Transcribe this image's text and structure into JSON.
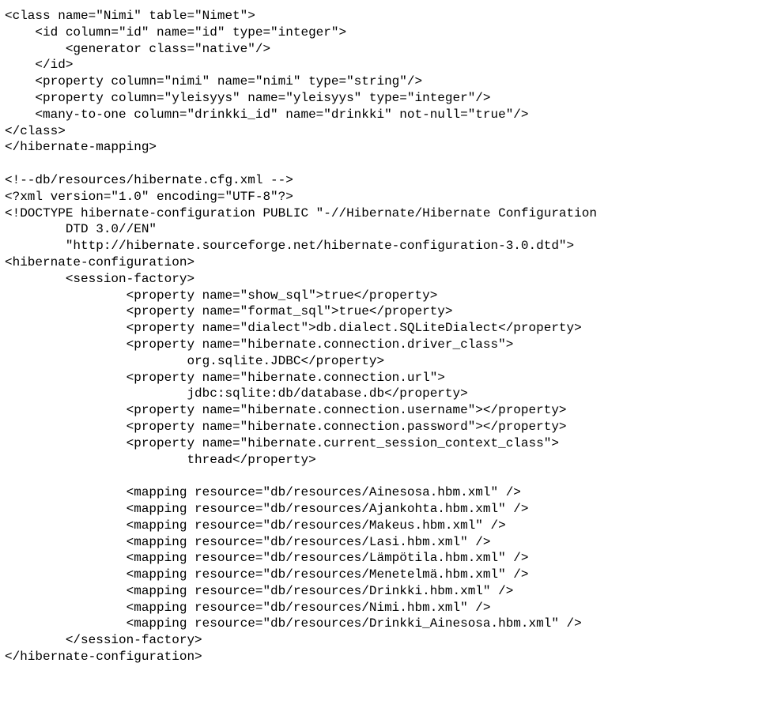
{
  "code": "<class name=\"Nimi\" table=\"Nimet\">\n    <id column=\"id\" name=\"id\" type=\"integer\">\n        <generator class=\"native\"/>\n    </id>\n    <property column=\"nimi\" name=\"nimi\" type=\"string\"/>\n    <property column=\"yleisyys\" name=\"yleisyys\" type=\"integer\"/>\n    <many-to-one column=\"drinkki_id\" name=\"drinkki\" not-null=\"true\"/>\n</class>\n</hibernate-mapping>\n\n<!--db/resources/hibernate.cfg.xml -->\n<?xml version=\"1.0\" encoding=\"UTF-8\"?>\n<!DOCTYPE hibernate-configuration PUBLIC \"-//Hibernate/Hibernate Configuration\n        DTD 3.0//EN\"\n        \"http://hibernate.sourceforge.net/hibernate-configuration-3.0.dtd\">\n<hibernate-configuration>\n        <session-factory>\n                <property name=\"show_sql\">true</property>\n                <property name=\"format_sql\">true</property>\n                <property name=\"dialect\">db.dialect.SQLiteDialect</property>\n                <property name=\"hibernate.connection.driver_class\">\n                        org.sqlite.JDBC</property>\n                <property name=\"hibernate.connection.url\">\n                        jdbc:sqlite:db/database.db</property>\n                <property name=\"hibernate.connection.username\"></property>\n                <property name=\"hibernate.connection.password\"></property>\n                <property name=\"hibernate.current_session_context_class\">\n                        thread</property>\n\n                <mapping resource=\"db/resources/Ainesosa.hbm.xml\" />\n                <mapping resource=\"db/resources/Ajankohta.hbm.xml\" />\n                <mapping resource=\"db/resources/Makeus.hbm.xml\" />\n                <mapping resource=\"db/resources/Lasi.hbm.xml\" />\n                <mapping resource=\"db/resources/Lämpötila.hbm.xml\" />\n                <mapping resource=\"db/resources/Menetelmä.hbm.xml\" />\n                <mapping resource=\"db/resources/Drinkki.hbm.xml\" />\n                <mapping resource=\"db/resources/Nimi.hbm.xml\" />\n                <mapping resource=\"db/resources/Drinkki_Ainesosa.hbm.xml\" />\n        </session-factory>\n</hibernate-configuration>"
}
